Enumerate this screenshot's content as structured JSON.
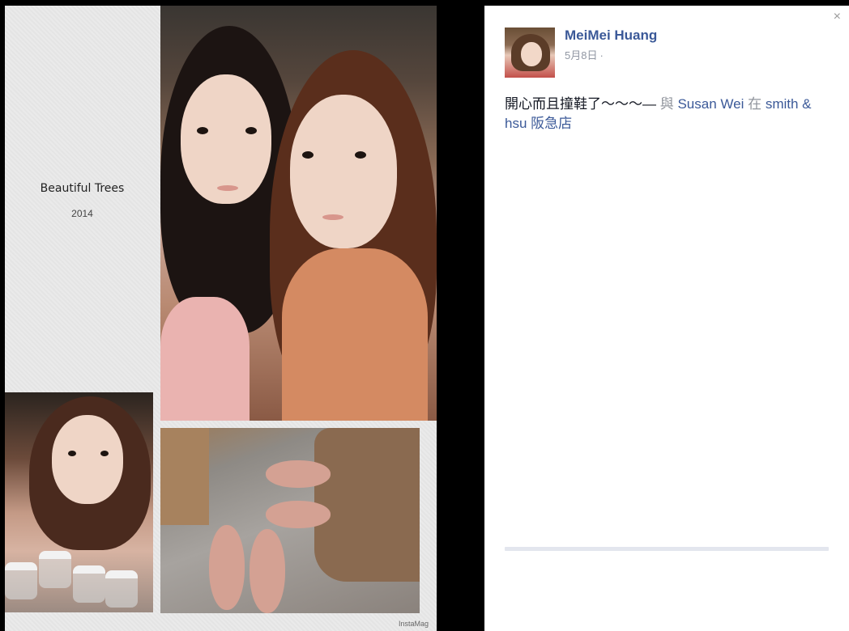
{
  "collage": {
    "title": "Beautiful Trees",
    "year": "2014",
    "watermark": "InstaMag"
  },
  "post": {
    "author_name": "MeiMei Huang",
    "date": "5月8日",
    "separator": "·",
    "text": "開心而且撞鞋了〜〜〜—",
    "with_word": "與",
    "tagged_friend": "Susan Wei",
    "at_word": "在",
    "place": "smith & hsu 阪急店"
  },
  "ui": {
    "close_symbol": "×"
  },
  "colors": {
    "link": "#3b5998",
    "muted": "#90949c",
    "backdrop": "#000000"
  }
}
